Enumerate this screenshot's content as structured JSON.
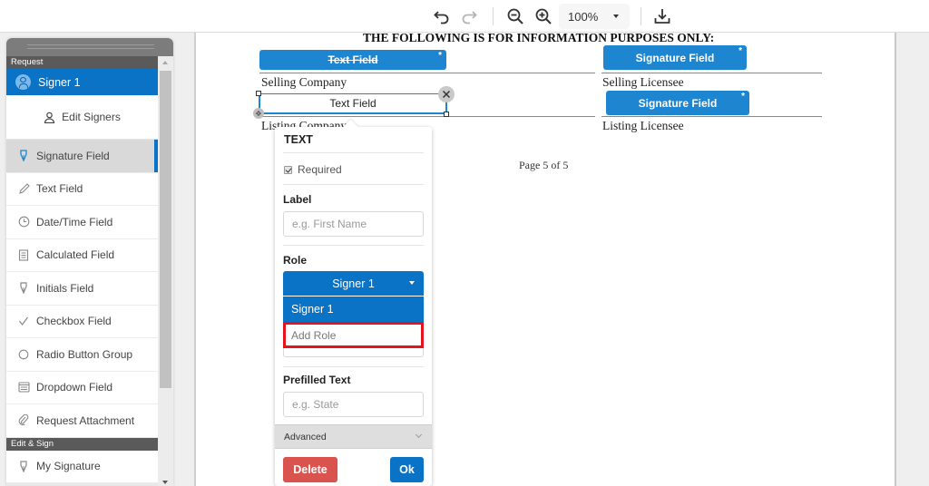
{
  "toolbar": {
    "undo_icon": "undo-icon",
    "redo_icon": "redo-icon",
    "zoom_out_icon": "zoom-out-icon",
    "zoom_in_icon": "zoom-in-icon",
    "zoom_level": "100%",
    "download_icon": "download-icon"
  },
  "sidebar": {
    "section_request": "Request",
    "signer": "Signer 1",
    "edit_signers": "Edit Signers",
    "items": [
      {
        "label": "Signature Field",
        "icon": "pen-nib-icon",
        "active": true
      },
      {
        "label": "Text Field",
        "icon": "pencil-icon"
      },
      {
        "label": "Date/Time Field",
        "icon": "clock-icon"
      },
      {
        "label": "Calculated Field",
        "icon": "calculator-icon"
      },
      {
        "label": "Initials Field",
        "icon": "pen-nib-icon"
      },
      {
        "label": "Checkbox Field",
        "icon": "check-icon"
      },
      {
        "label": "Radio Button Group",
        "icon": "radio-icon"
      },
      {
        "label": "Dropdown Field",
        "icon": "dropdown-list-icon"
      },
      {
        "label": "Request Attachment",
        "icon": "paperclip-icon"
      }
    ],
    "section_edit_sign": "Edit & Sign",
    "edit_items": [
      {
        "label": "My Signature",
        "icon": "pen-nib-icon"
      }
    ]
  },
  "document": {
    "heading": "THE FOLLOWING IS FOR INFORMATION PURPOSES ONLY:",
    "fields": {
      "text_field_1": "Text Field",
      "text_field_selected": "Text Field",
      "signature_field_1": "Signature Field",
      "signature_field_2": "Signature Field",
      "required_mark": "*"
    },
    "labels": {
      "selling_company": "Selling Company",
      "listing_company": "Listing Company",
      "selling_licensee": "Selling Licensee",
      "listing_licensee": "Listing Licensee"
    },
    "page_indicator": "Page 5 of 5"
  },
  "popover": {
    "title": "TEXT",
    "required_label": "Required",
    "required_checked": true,
    "label_heading": "Label",
    "label_placeholder": "e.g. First Name",
    "role_heading": "Role",
    "role_selected": "Signer 1",
    "role_options": [
      "Signer 1",
      "Add Role"
    ],
    "prefilled_heading": "Prefilled Text",
    "prefilled_placeholder": "e.g. State",
    "advanced_label": "Advanced",
    "delete_label": "Delete",
    "ok_label": "Ok"
  },
  "colors": {
    "accent": "#0a73c6",
    "field_blue": "#1e86d0",
    "delete_red": "#d9534f",
    "highlight_red": "#e3141b"
  }
}
